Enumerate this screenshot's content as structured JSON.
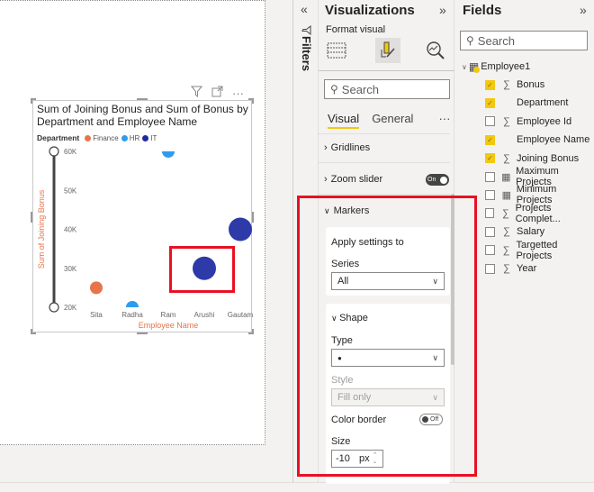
{
  "visual_header": {
    "filter_icon": "filter-icon",
    "focus_icon": "focus-mode-icon",
    "more_label": "···"
  },
  "chart_data": {
    "type": "scatter",
    "title": "Sum of Joining Bonus and Sum of Bonus by Department and Employee Name",
    "xlabel": "Employee Name",
    "ylabel": "Sum of Joining Bonus",
    "legend_title": "Department",
    "legend": [
      {
        "name": "Finance",
        "color": "#e8744a"
      },
      {
        "name": "HR",
        "color": "#2d9cf0"
      },
      {
        "name": "IT",
        "color": "#1e2a9c"
      }
    ],
    "legend_position": "top-left",
    "categories": [
      "Sita",
      "Radha",
      "Ram",
      "Arushi",
      "Gautam"
    ],
    "yticks": [
      "20K",
      "30K",
      "40K",
      "50K",
      "60K"
    ],
    "ylim": [
      20000,
      60000
    ],
    "points": [
      {
        "x": "Sita",
        "y": 25000,
        "dept": "Finance",
        "size": "small"
      },
      {
        "x": "Radha",
        "y": 20000,
        "dept": "HR",
        "size": "small"
      },
      {
        "x": "Ram",
        "y": 60000,
        "dept": "HR",
        "size": "small"
      },
      {
        "x": "Arushi",
        "y": 30000,
        "dept": "IT",
        "size": "large"
      },
      {
        "x": "Gautam",
        "y": 40000,
        "dept": "IT",
        "size": "large"
      }
    ],
    "zoom_slider": true
  },
  "filters": {
    "label": "Filters",
    "collapse_icon": "«"
  },
  "viz": {
    "title": "Visualizations",
    "expand_icon": "»",
    "format_label": "Format visual",
    "search_placeholder": "Search",
    "tabs": [
      "Visual",
      "General"
    ],
    "more": "···",
    "gridlines": "Gridlines",
    "zoom_slider": "Zoom slider",
    "zoom_toggle": "On",
    "markers": "Markers",
    "apply_settings": "Apply settings to",
    "series_label": "Series",
    "series_value": "All",
    "shape": "Shape",
    "type_label": "Type",
    "type_value": "●",
    "style_label": "Style",
    "style_value": "Fill only",
    "color_border": "Color border",
    "color_border_toggle": "Off",
    "size_label": "Size",
    "size_value": "-10",
    "size_unit": "px"
  },
  "fields": {
    "title": "Fields",
    "expand_icon": "»",
    "search_placeholder": "Search",
    "table": "Employee1",
    "items": [
      {
        "label": "Bonus",
        "checked": true,
        "icon": "∑"
      },
      {
        "label": "Department",
        "checked": true,
        "icon": ""
      },
      {
        "label": "Employee Id",
        "checked": false,
        "icon": "∑"
      },
      {
        "label": "Employee Name",
        "checked": true,
        "icon": ""
      },
      {
        "label": "Joining Bonus",
        "checked": true,
        "icon": "∑"
      },
      {
        "label": "Maximum Projects",
        "checked": false,
        "icon": "▦"
      },
      {
        "label": "Minimum Projects",
        "checked": false,
        "icon": "▦"
      },
      {
        "label": "Projects Complet...",
        "checked": false,
        "icon": "∑"
      },
      {
        "label": "Salary",
        "checked": false,
        "icon": "∑"
      },
      {
        "label": "Targetted Projects",
        "checked": false,
        "icon": "∑"
      },
      {
        "label": "Year",
        "checked": false,
        "icon": "∑"
      }
    ]
  }
}
